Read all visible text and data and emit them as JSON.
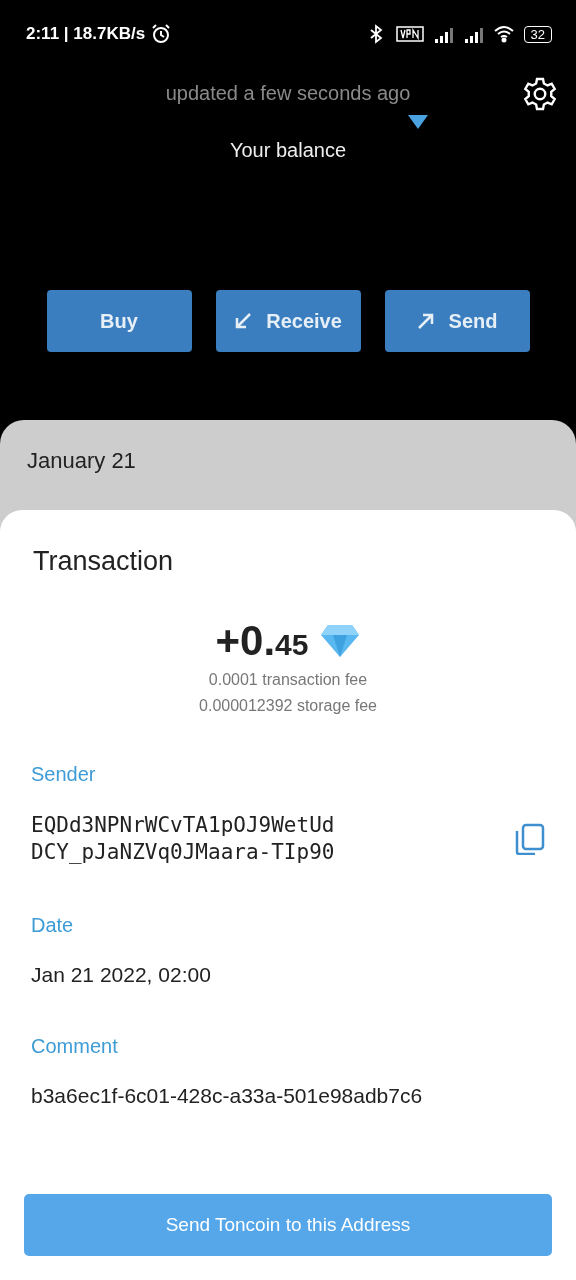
{
  "status_bar": {
    "time": "2:11 | 18.7KB/s",
    "battery": "32"
  },
  "wallet": {
    "updated": "updated a few seconds ago",
    "balance_label": "Your balance"
  },
  "actions": [
    {
      "label": "Buy",
      "kind": "plain"
    },
    {
      "label": "Receive",
      "kind": "receive"
    },
    {
      "label": "Send",
      "kind": "send"
    }
  ],
  "history": {
    "date": "January 21"
  },
  "transaction": {
    "title": "Transaction",
    "amount": {
      "whole": "+0.",
      "fraction": "45"
    },
    "fees": [
      "0.0001 transaction fee",
      "0.000012392 storage fee"
    ],
    "fields": [
      {
        "label": "Sender",
        "kind": "address",
        "lines": [
          "EQDd3NPNrWCvTA1pOJ9WetUd",
          "DCY_pJaNZVq0JMaara-TIp90"
        ]
      },
      {
        "label": "Date",
        "kind": "text",
        "lines": [
          "Jan 21 2022, 02:00"
        ]
      },
      {
        "label": "Comment",
        "kind": "text",
        "lines": [
          "b3a6ec1f-6c01-428c-a33a-501e98adb7c6"
        ]
      }
    ],
    "button": "Send Toncoin to this Address"
  }
}
